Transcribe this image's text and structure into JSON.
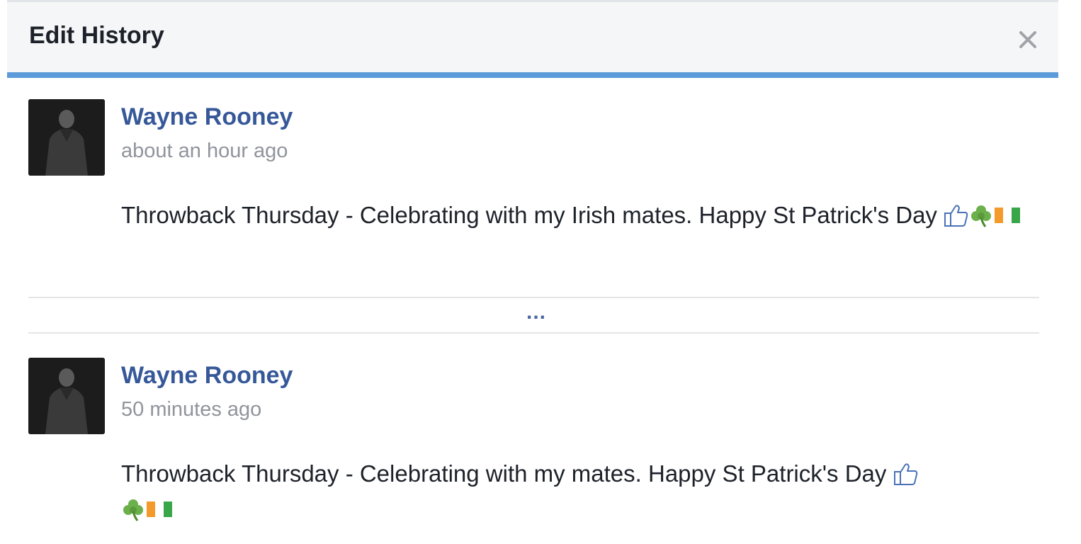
{
  "dialog": {
    "title": "Edit History",
    "close_icon": "close-icon"
  },
  "entries": [
    {
      "author": "Wayne Rooney",
      "timestamp": "about an hour ago",
      "text": "Throwback Thursday - Celebrating with my Irish mates. Happy St Patrick's Day",
      "emojis": [
        "thumbs-up-icon",
        "shamrock-icon",
        "irish-flag-icon"
      ]
    },
    {
      "author": "Wayne Rooney",
      "timestamp": "50 minutes ago",
      "text": "Throwback Thursday - Celebrating with my mates. Happy St Patrick's Day",
      "emojis": [
        "thumbs-up-icon",
        "shamrock-icon",
        "irish-flag-icon"
      ]
    }
  ],
  "separator": {
    "more_label": "..."
  },
  "colors": {
    "accent_border": "#5b9bd9",
    "name_link": "#365899",
    "timestamp": "#90949c",
    "header_bg": "#f5f6f7"
  }
}
